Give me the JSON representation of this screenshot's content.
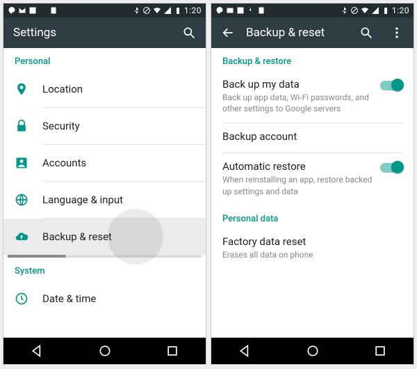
{
  "status": {
    "time": "1:20"
  },
  "left": {
    "title": "Settings",
    "sections": {
      "personal": {
        "header": "Personal",
        "items": {
          "location": "Location",
          "security": "Security",
          "accounts": "Accounts",
          "language": "Language & input",
          "backup": "Backup & reset"
        }
      },
      "system": {
        "header": "System",
        "items": {
          "datetime": "Date & time"
        }
      }
    }
  },
  "right": {
    "title": "Backup & reset",
    "sections": {
      "backup_restore": {
        "header": "Backup & restore",
        "backup_data": {
          "title": "Back up my data",
          "sub": "Back up app data, Wi-Fi passwords, and other settings to Google servers"
        },
        "backup_account": {
          "title": "Backup account"
        },
        "auto_restore": {
          "title": "Automatic restore",
          "sub": "When reinstalling an app, restore backed up settings and data"
        }
      },
      "personal_data": {
        "header": "Personal data",
        "factory_reset": {
          "title": "Factory data reset",
          "sub": "Erases all data on phone"
        }
      }
    }
  }
}
